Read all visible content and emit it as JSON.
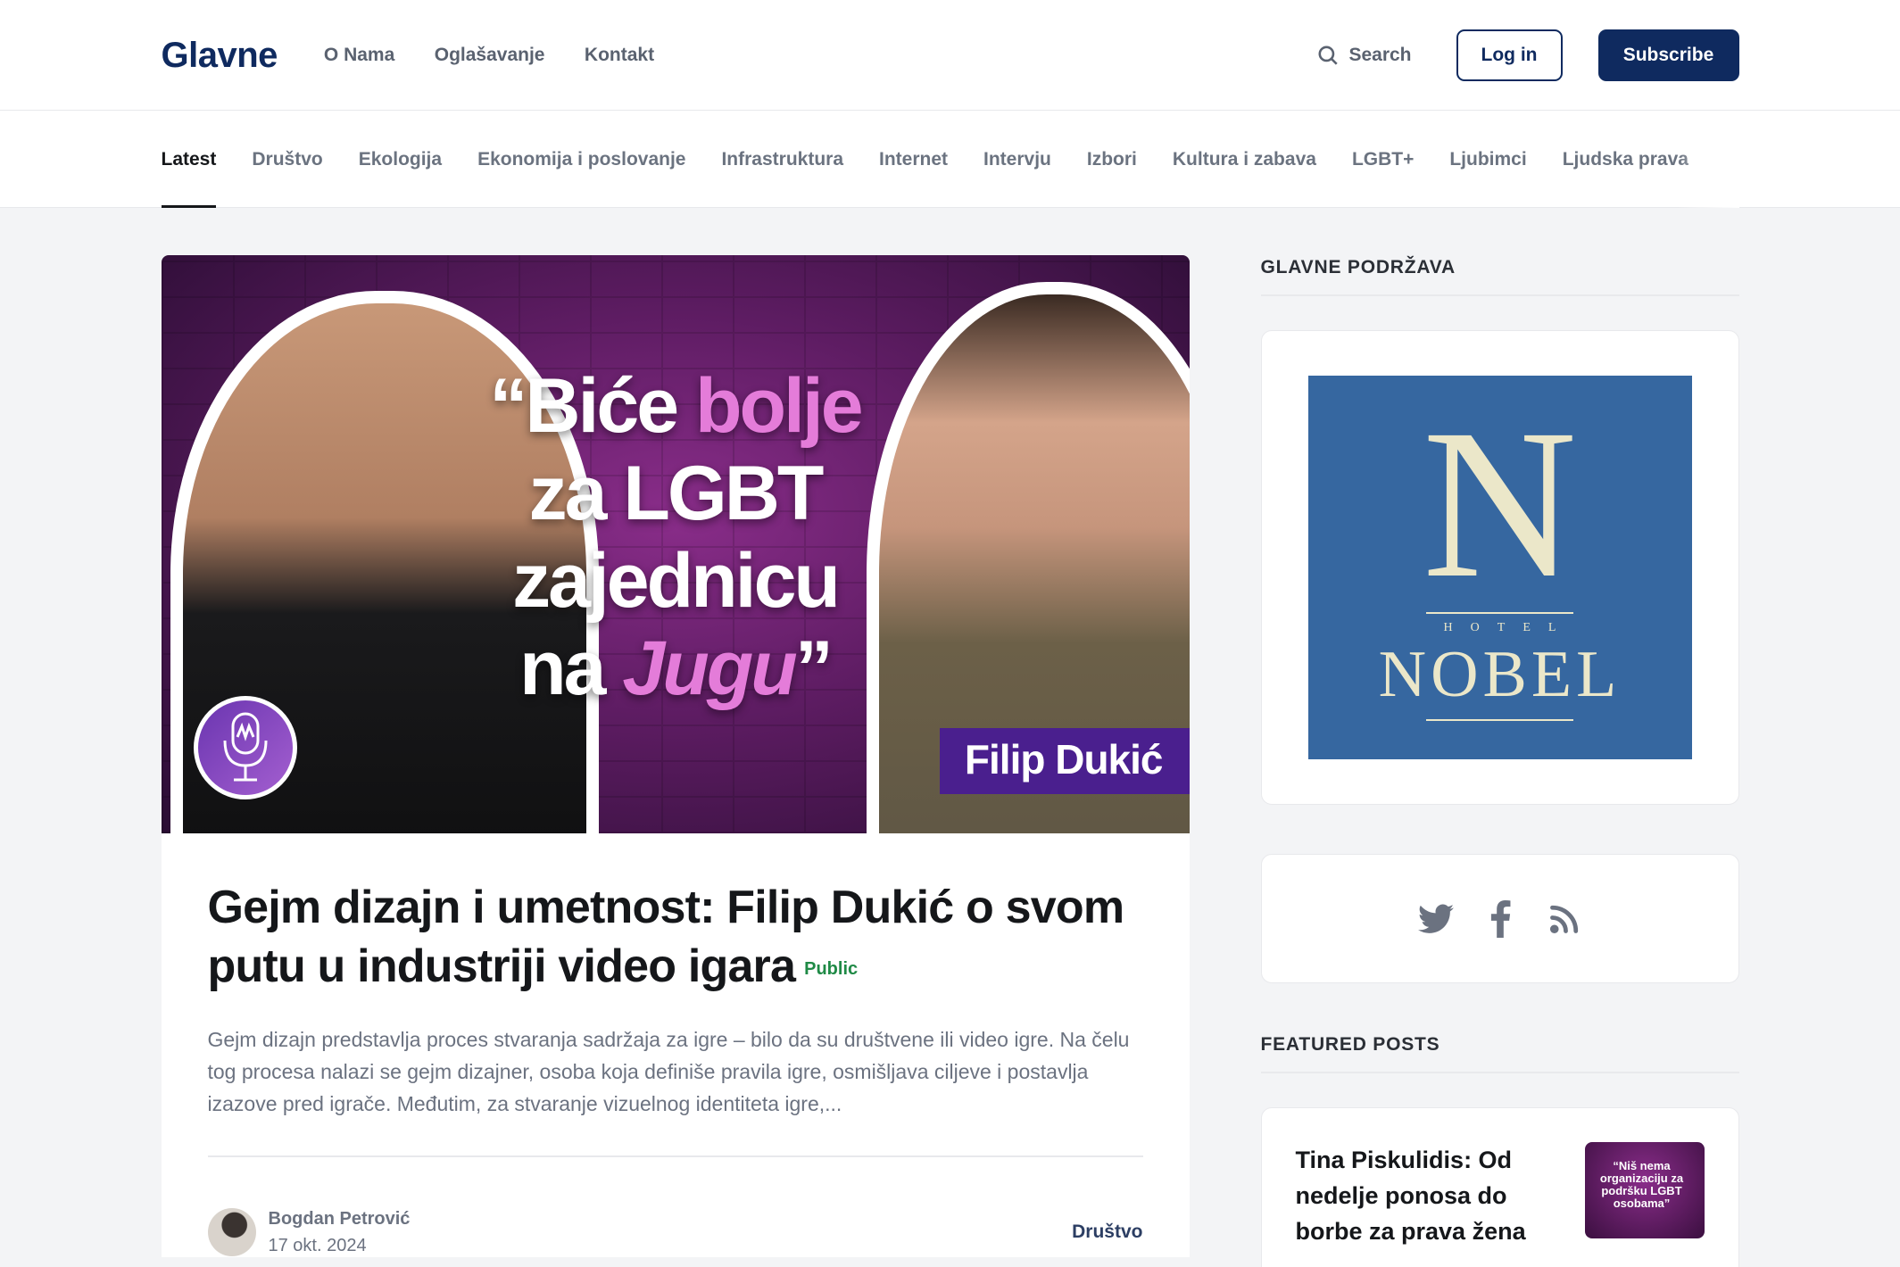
{
  "header": {
    "logo": "Glavne",
    "nav": [
      "O Nama",
      "Oglašavanje",
      "Kontakt"
    ],
    "search_label": "Search",
    "login_label": "Log in",
    "subscribe_label": "Subscribe"
  },
  "categories": [
    "Latest",
    "Društvo",
    "Ekologija",
    "Ekonomija i poslovanje",
    "Infrastruktura",
    "Internet",
    "Intervju",
    "Izbori",
    "Kultura i zabava",
    "LGBT+",
    "Ljubimci",
    "Ljudska prava"
  ],
  "active_category": "Latest",
  "post": {
    "hero": {
      "quote_line1_a": "“Biće ",
      "quote_line1_b": "bolje",
      "quote_line2": "za LGBT",
      "quote_line3": "zajednicu",
      "quote_line4_a": "na ",
      "quote_line4_b": "Jugu",
      "quote_line4_c": "”",
      "name_tag": "Filip Dukić"
    },
    "title": "Gejm dizajn i umetnost: Filip Dukić o svom putu u industriji video igara",
    "visibility": "Public",
    "excerpt": "Gejm dizajn predstavlja proces stvaranja sadržaja za igre – bilo da su društvene ili video igre. Na čelu tog procesa nalazi se gejm dizajner, osoba koja definiše pravila igre, osmišljava ciljeve i postavlja izazove pred igrače. Međutim, za stvaranje vizuelnog identiteta igre,...",
    "author": "Bogdan Petrović",
    "date": "17 okt. 2024",
    "tag": "Društvo"
  },
  "sidebar": {
    "sponsor_heading": "GLAVNE PODRŽAVA",
    "sponsor": {
      "initial": "N",
      "small": "HOTEL",
      "name": "NOBEL",
      "bg_color": "#3667a0",
      "fg_color": "#ebe7c9"
    },
    "social_icons": [
      "twitter-icon",
      "facebook-icon",
      "rss-icon"
    ],
    "featured_heading": "FEATURED POSTS",
    "featured": [
      {
        "title": "Tina Piskulidis: Od nedelje ponosa do borbe za prava žena",
        "thumb_text": "“Niš nema organizaciju za podršku LGBT osobama”"
      }
    ]
  },
  "colors": {
    "brand": "#0f2a5f",
    "public": "#1f8a46",
    "hero_magenta": "#e47cd9"
  }
}
